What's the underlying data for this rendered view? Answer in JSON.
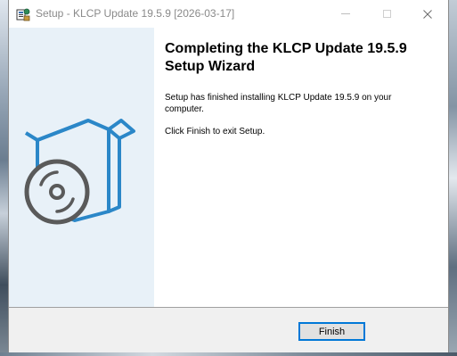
{
  "window": {
    "title": "Setup - KLCP Update 19.5.9 [2026-03-17]",
    "minimize_icon": "minimize-icon",
    "maximize_icon": "maximize-icon",
    "close_icon": "close-icon",
    "app_icon": "setup-app-icon"
  },
  "main": {
    "heading": "Completing the KLCP Update 19.5.9 Setup Wizard",
    "paragraph_1": "Setup has finished installing KLCP Update 19.5.9 on your computer.",
    "paragraph_2": "Click Finish to exit Setup.",
    "illustration": "software-box-with-disc-icon"
  },
  "footer": {
    "finish_label": "Finish"
  },
  "colors": {
    "side_panel": "#e8f1f8",
    "box_outline": "#2b87c8",
    "disc": "#5a5a5a",
    "button_focus": "#0078d7",
    "footer": "#f0f0f0"
  }
}
